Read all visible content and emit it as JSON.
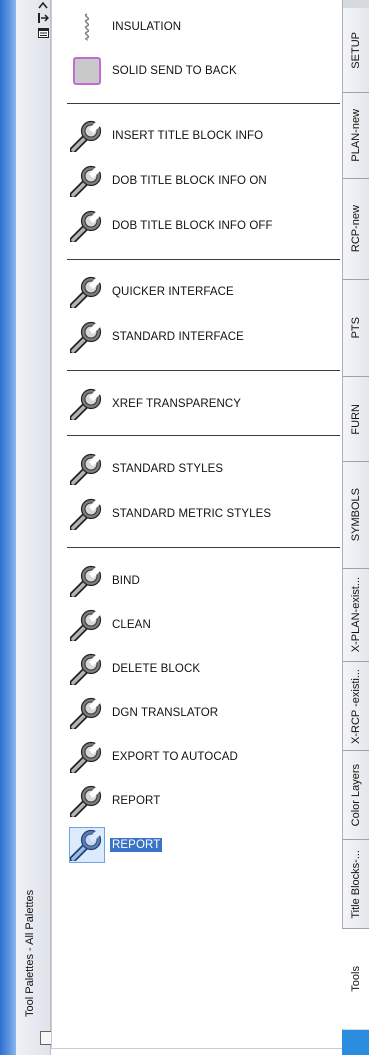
{
  "window": {
    "title": "Tool Palettes - All Palettes",
    "icons": [
      "chevron-up-icon",
      "auto-hide-icon",
      "properties-icon"
    ]
  },
  "palette": {
    "items": [
      {
        "label": "INSULATION",
        "icon": "insulation-icon"
      },
      {
        "label": "SOLID SEND TO BACK",
        "icon": "solid-fill-icon"
      },
      {
        "label": "INSERT TITLE BLOCK INFO",
        "icon": "wrench-icon"
      },
      {
        "label": "DOB TITLE BLOCK INFO ON",
        "icon": "wrench-icon"
      },
      {
        "label": "DOB TITLE BLOCK INFO OFF",
        "icon": "wrench-icon"
      },
      {
        "label": "QUICKER INTERFACE",
        "icon": "wrench-icon"
      },
      {
        "label": "STANDARD INTERFACE",
        "icon": "wrench-icon"
      },
      {
        "label": "XREF TRANSPARENCY",
        "icon": "wrench-icon"
      },
      {
        "label": "STANDARD STYLES",
        "icon": "wrench-icon"
      },
      {
        "label": "STANDARD METRIC STYLES",
        "icon": "wrench-icon"
      },
      {
        "label": "BIND",
        "icon": "wrench-icon"
      },
      {
        "label": "CLEAN",
        "icon": "wrench-icon"
      },
      {
        "label": "DELETE BLOCK",
        "icon": "wrench-icon"
      },
      {
        "label": "DGN TRANSLATOR",
        "icon": "wrench-icon"
      },
      {
        "label": "EXPORT TO AUTOCAD",
        "icon": "wrench-icon"
      },
      {
        "label": "REPORT",
        "icon": "wrench-icon"
      },
      {
        "label": "REPORT",
        "icon": "wrench-icon",
        "selected": true
      }
    ]
  },
  "tabs": [
    {
      "label": "SETUP"
    },
    {
      "label": "PLAN-new"
    },
    {
      "label": "RCP-new"
    },
    {
      "label": "PTS"
    },
    {
      "label": "FURN"
    },
    {
      "label": "SYMBOLS"
    },
    {
      "label": "X-PLAN-exist..."
    },
    {
      "label": "X-RCP -existi..."
    },
    {
      "label": "Color Layers"
    },
    {
      "label": "Title Blocks-..."
    },
    {
      "label": "Tools",
      "active": true
    }
  ],
  "colors": {
    "selection": "#3a73c5",
    "accent": "#2a8de0",
    "solid_swatch_border": "#c46ad6"
  }
}
